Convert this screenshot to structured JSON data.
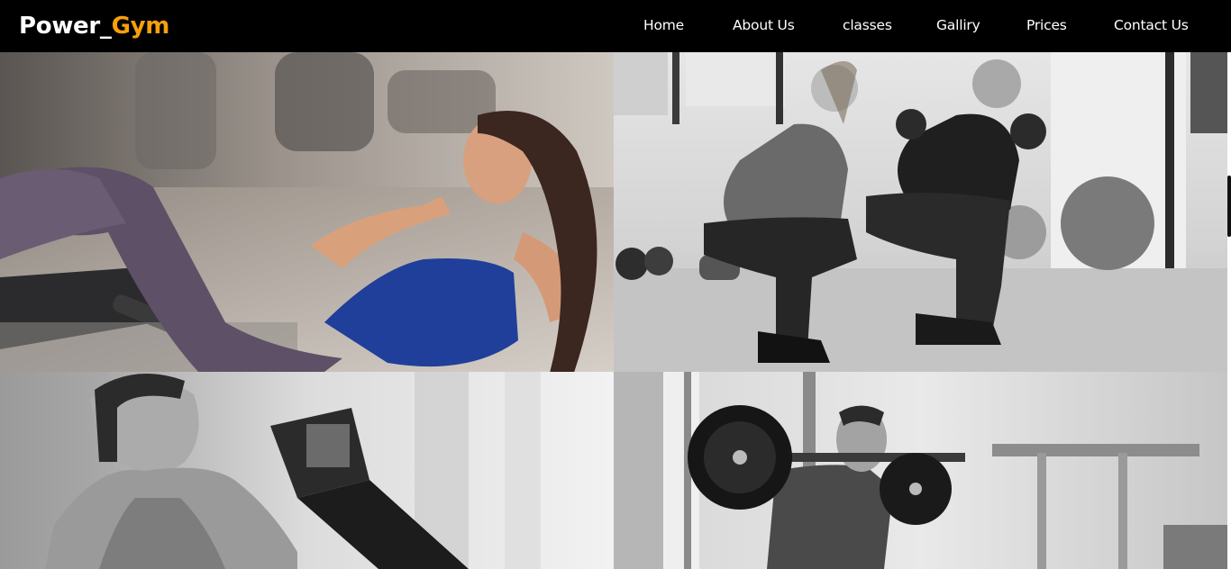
{
  "brand": {
    "name_part1": "Power_",
    "name_part2": "Gym",
    "accent_color": "#f5a00c"
  },
  "nav": {
    "items": [
      {
        "label": "Home"
      },
      {
        "label": "About Us"
      },
      {
        "label": "classes"
      },
      {
        "label": "Galliry"
      },
      {
        "label": "Prices"
      },
      {
        "label": "Contact Us"
      }
    ]
  },
  "gallery": {
    "images": [
      {
        "name": "woman-doing-crunches-photo",
        "style": "color"
      },
      {
        "name": "couple-squatting-with-kettlebells-photo",
        "style": "grayscale"
      },
      {
        "name": "woman-on-rowing-machine-photo",
        "style": "grayscale"
      },
      {
        "name": "man-barbell-squat-photo",
        "style": "grayscale"
      }
    ]
  }
}
